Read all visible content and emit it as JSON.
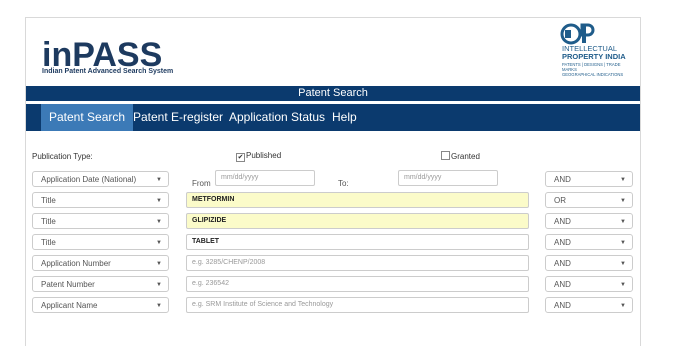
{
  "header": {
    "logo_text": "inPASS",
    "logo_subtitle": "Indian Patent Advanced Search System",
    "ip_logo_line1": "INTELLECTUAL",
    "ip_logo_line2": "PROPERTY INDIA",
    "ip_logo_line3": "PATENTS | DESIGNS | TRADE MARKS",
    "ip_logo_line4": "GEOGRAPHICAL INDICATIONS"
  },
  "title_bar": "Patent Search",
  "nav": {
    "items": [
      {
        "label": "Patent Search",
        "active": true
      },
      {
        "label": "Patent E-register",
        "active": false
      },
      {
        "label": "Application Status",
        "active": false
      },
      {
        "label": "Help",
        "active": false
      }
    ]
  },
  "publication": {
    "label": "Publication Type:",
    "published_label": "Published",
    "published_checked": true,
    "granted_label": "Granted",
    "granted_checked": false
  },
  "date_row": {
    "field": "Application Date (National)",
    "from_label": "From",
    "from_placeholder": "mm/dd/yyyy",
    "to_label": "To:",
    "to_placeholder": "mm/dd/yyyy",
    "operator": "AND"
  },
  "rows": [
    {
      "field": "Title",
      "value": "METFORMIN",
      "placeholder": "",
      "operator": "OR"
    },
    {
      "field": "Title",
      "value": "GLIPIZIDE",
      "placeholder": "",
      "operator": "AND"
    },
    {
      "field": "Title",
      "value": "TABLET",
      "placeholder": "",
      "operator": "AND"
    },
    {
      "field": "Application Number",
      "value": "",
      "placeholder": "e.g. 3285/CHENP/2008",
      "operator": "AND"
    },
    {
      "field": "Patent Number",
      "value": "",
      "placeholder": "e.g. 236542",
      "operator": "AND"
    },
    {
      "field": "Applicant Name",
      "value": "",
      "placeholder": "e.g. SRM Institute of Science and Technology",
      "operator": "AND"
    }
  ],
  "caret": "▼",
  "checkmark": "✔",
  "colors": {
    "nav_bg": "#0b3a6e",
    "nav_active": "#3c7ab7",
    "highlight": "#fbfbc9"
  }
}
